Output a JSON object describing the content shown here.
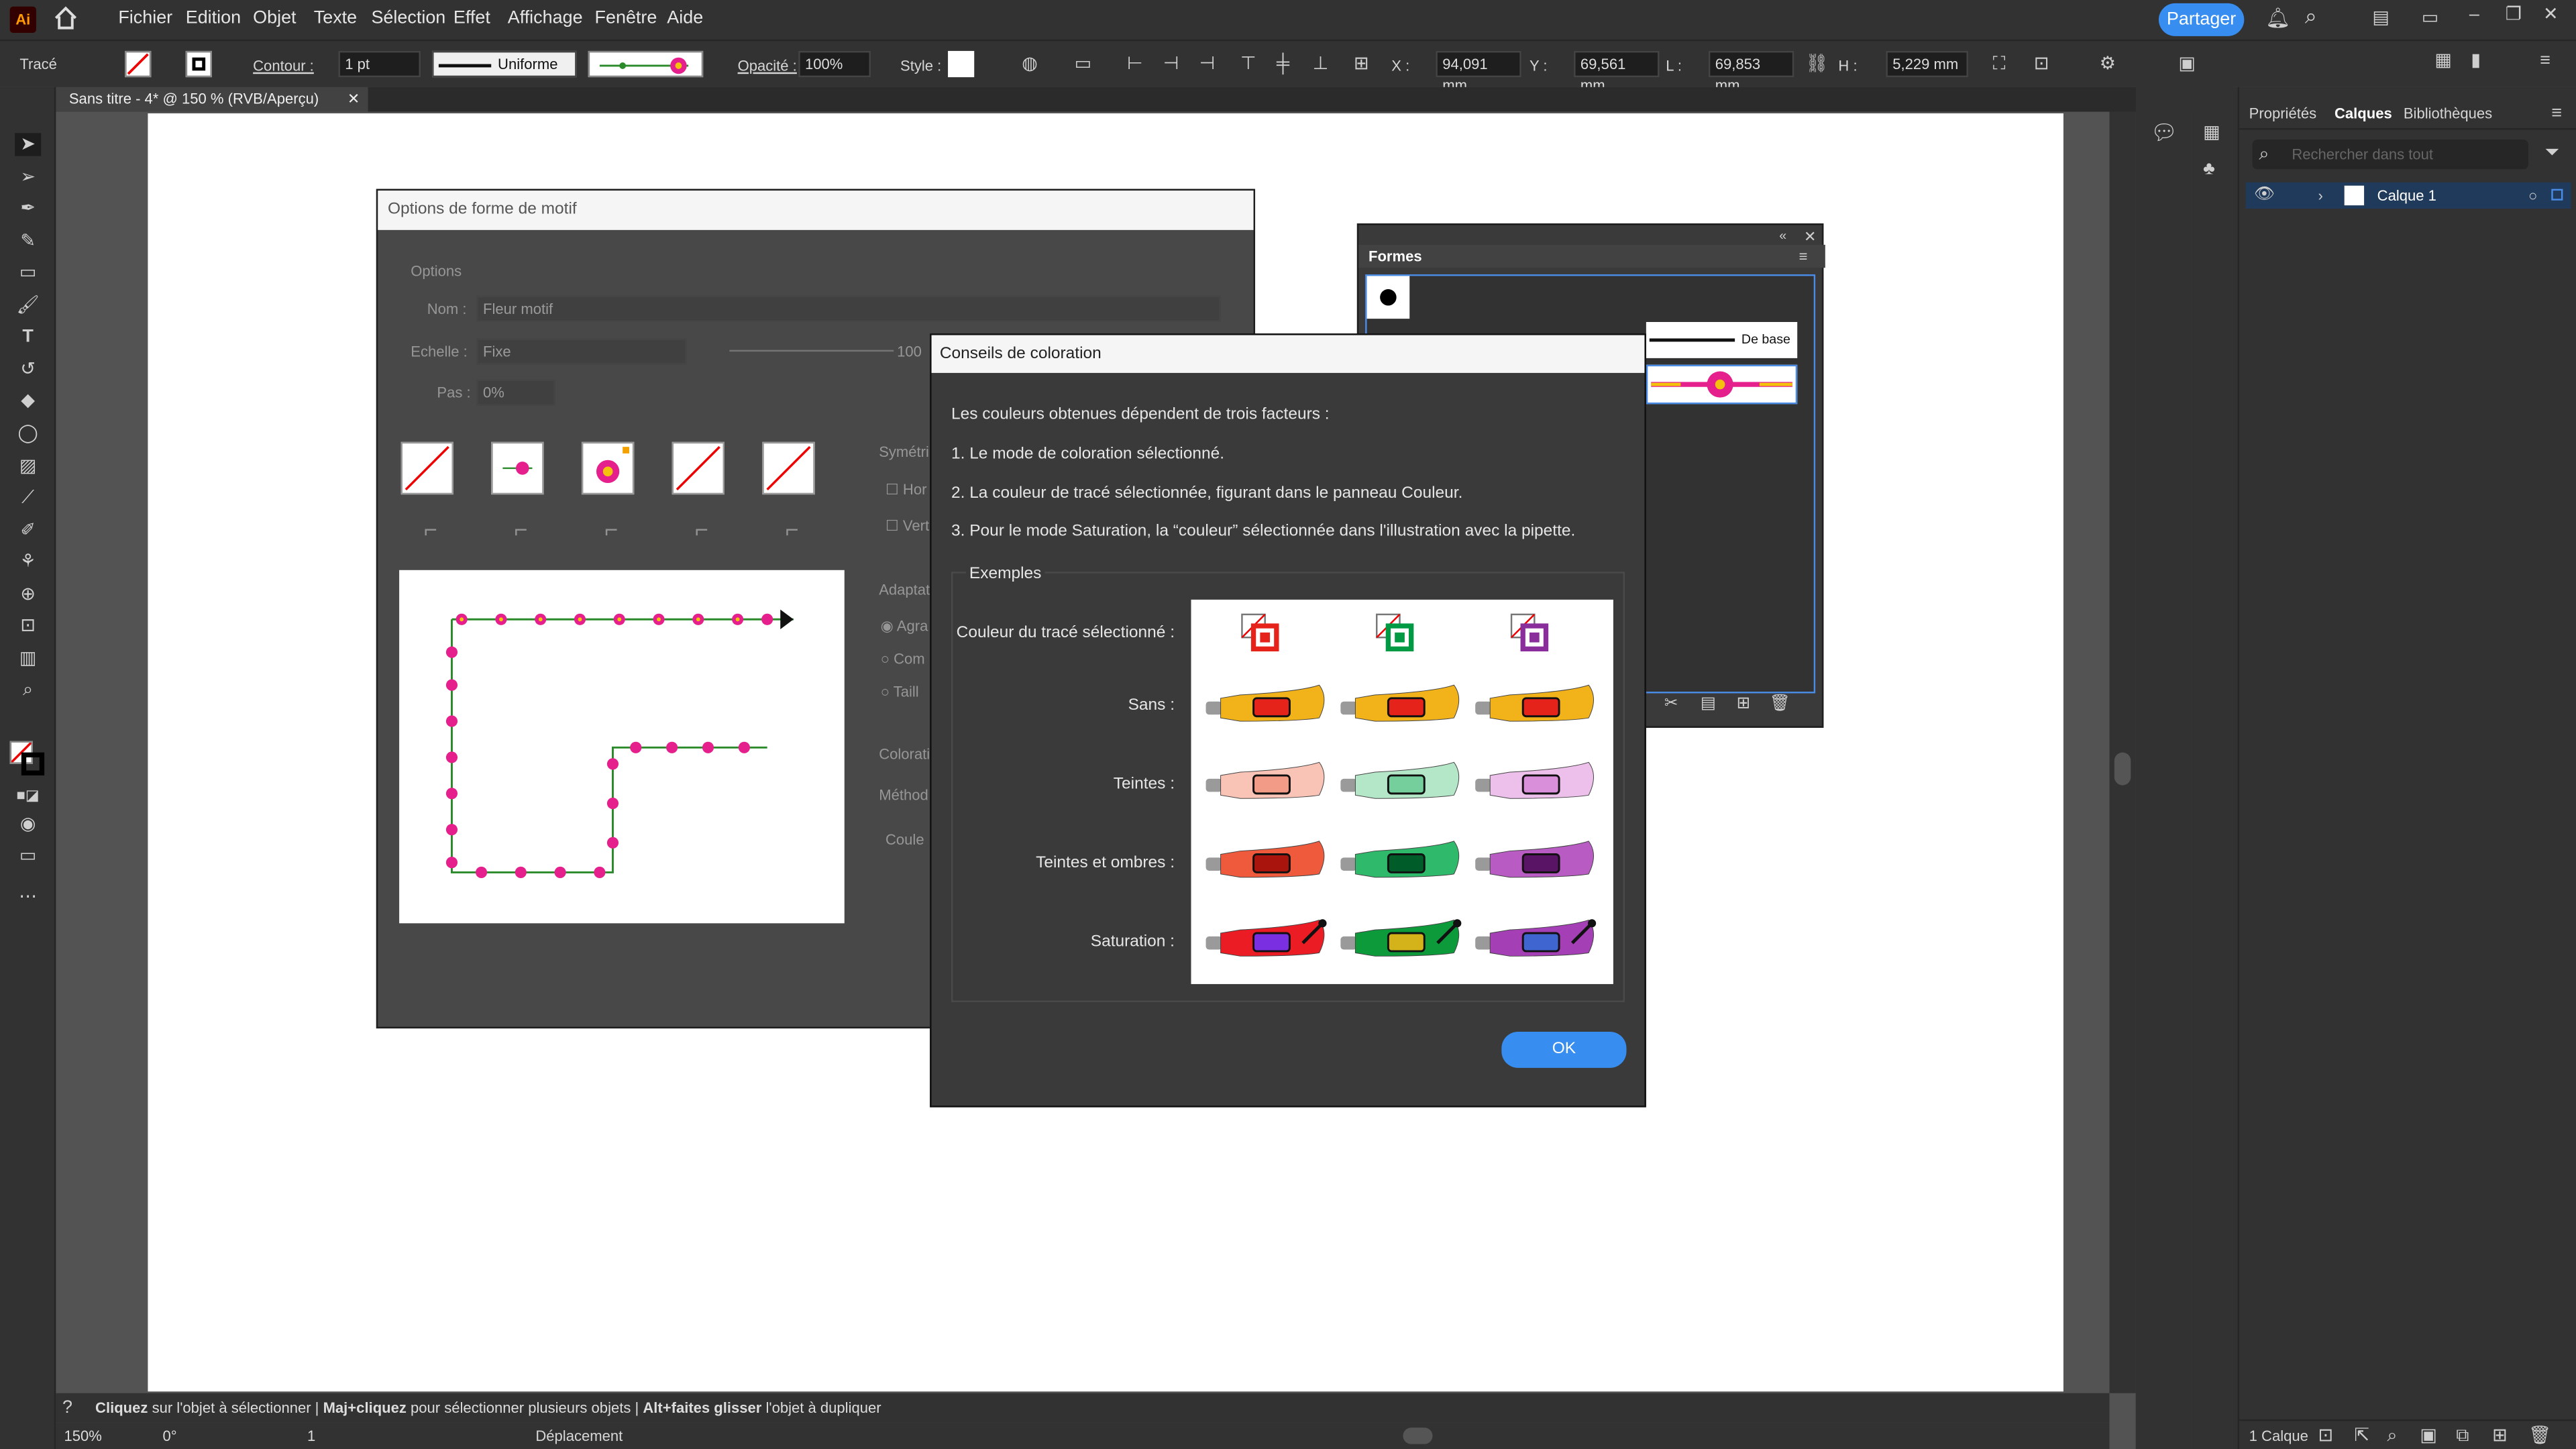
{
  "app": {
    "logo": "Ai",
    "menus": [
      "Fichier",
      "Edition",
      "Objet",
      "Texte",
      "Sélection",
      "Effet",
      "Affichage",
      "Fenêtre",
      "Aide"
    ],
    "share_label": "Partager"
  },
  "control": {
    "object_type": "Tracé",
    "stroke_label": "Contour :",
    "stroke_value": "1 pt",
    "stroke_profile": "Uniforme",
    "opacity_label": "Opacité :",
    "opacity_value": "100%",
    "style_label": "Style :",
    "x_label": "X :",
    "x_value": "94,091 mm",
    "y_label": "Y :",
    "y_value": "69,561 mm",
    "w_label": "L :",
    "w_value": "69,853 mm",
    "h_label": "H :",
    "h_value": "5,229 mm"
  },
  "doc_tab": {
    "title": "Sans titre - 4* @ 150 % (RVB/Aperçu)"
  },
  "pattern_dialog": {
    "title": "Options de forme de motif",
    "options_label": "Options",
    "name_label": "Nom :",
    "name_value": "Fleur motif",
    "scale_label": "Echelle :",
    "scale_value": "Fixe",
    "scale_pct": "100",
    "step_label": "Pas :",
    "step_value": "0%",
    "sym_label": "Symétri",
    "hor": "Hor",
    "vert": "Vert",
    "adapt_label": "Adaptat",
    "radio1": "Agra",
    "radio2": "Com",
    "radio3": "Taill",
    "coloration_label": "Colorati",
    "method_label": "Méthod",
    "color_label": "Coule"
  },
  "formes_panel": {
    "title": "Formes",
    "basic_label": "De base"
  },
  "tips_dialog": {
    "title": "Conseils de coloration",
    "intro": "Les couleurs obtenues dépendent de trois facteurs :",
    "point1": "1. Le mode de coloration sélectionné.",
    "point2": "2. La couleur de tracé sélectionnée, figurant dans le panneau Couleur.",
    "point3": "3. Pour le mode Saturation, la “couleur” sélectionnée dans l'illustration avec la pipette.",
    "examples_label": "Exemples",
    "row_stroke": "Couleur du tracé sélectionné :",
    "row_none": "Sans :",
    "row_tints": "Teintes :",
    "row_tints_shades": "Teintes et ombres :",
    "row_saturation": "Saturation :",
    "ok_label": "OK",
    "stroke_colors": [
      "#e5231b",
      "#009a44",
      "#8a2e9b"
    ],
    "none_colors": {
      "tube": "#f2b21a",
      "cap": "#e5231b"
    },
    "tint_colors": [
      {
        "tube": "#f9c3b5",
        "cap": "#f29b86"
      },
      {
        "tube": "#b4e6c8",
        "cap": "#74cf9d"
      },
      {
        "tube": "#edc0ec",
        "cap": "#d98fd9"
      }
    ],
    "shade_colors": [
      {
        "tube": "#f05a3c",
        "cap": "#a9140d"
      },
      {
        "tube": "#2fb96a",
        "cap": "#005c28"
      },
      {
        "tube": "#b85cc4",
        "cap": "#5a1466"
      }
    ],
    "sat_colors": [
      {
        "tube": "#ec1c24",
        "cap": "#7a2fe0"
      },
      {
        "tube": "#0c9a3b",
        "cap": "#d4b21a"
      },
      {
        "tube": "#a43fb5",
        "cap": "#3f66d0"
      }
    ]
  },
  "panel": {
    "tabs": [
      "Propriétés",
      "Calques",
      "Bibliothèques"
    ],
    "search_placeholder": "Rechercher dans tout",
    "layer_name": "Calque 1",
    "layer_count": "1 Calque"
  },
  "status": {
    "hint1": "Cliquez",
    "hint1b": " sur l'objet à sélectionner  |  ",
    "hint2": "Maj+cliquez",
    "hint2b": " pour sélectionner plusieurs objets  |  ",
    "hint3": "Alt+faites glisser",
    "hint3b": " l'objet à dupliquer"
  },
  "bottom": {
    "zoom": "150%",
    "rotation": "0°",
    "artboard": "1",
    "mode": "Déplacement"
  }
}
